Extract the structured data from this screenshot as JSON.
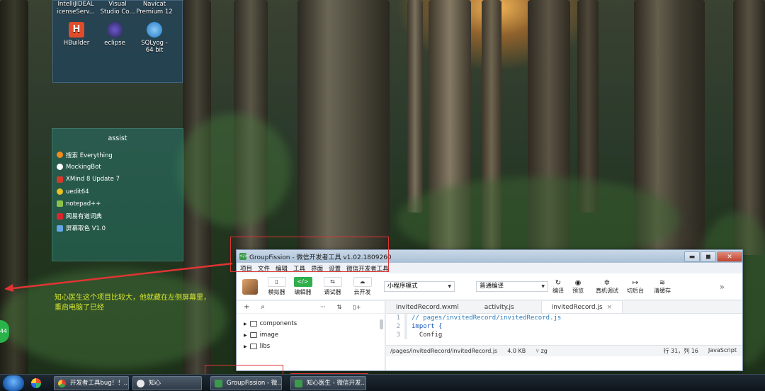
{
  "desktop": {
    "top_labels": [
      {
        "lines": [
          "IntelliJIDEAL",
          "icenseServ..."
        ]
      },
      {
        "lines": [
          "Visual",
          "Studio Co..."
        ]
      },
      {
        "lines": [
          "Navicat",
          "Premium 12"
        ]
      }
    ],
    "icons": [
      {
        "label": "HBuilder",
        "color": "#e04b2a"
      },
      {
        "label": "eclipse",
        "color": "#2c2255"
      },
      {
        "label": "SQLyog - 64 bit",
        "color": "#1f77c9"
      }
    ]
  },
  "assist": {
    "title": "assist",
    "items": [
      {
        "label": "搜索 Everything",
        "color": "#f28b1c"
      },
      {
        "label": "MockingBot",
        "color": "#ffffff"
      },
      {
        "label": "XMind 8 Update 7",
        "color": "#d33a2c"
      },
      {
        "label": "uedit64",
        "color": "#e8c21e"
      },
      {
        "label": "notepad++",
        "color": "#8bc34a"
      },
      {
        "label": "网易有道词典",
        "color": "#d8262e"
      },
      {
        "label": "屏幕取色 V1.0",
        "color": "#63a7e6"
      }
    ]
  },
  "annotation": {
    "note_line1": "知心医生这个项目比较大，他就藏在左侧屏幕里，",
    "note_line2": "重启电脑了已经",
    "red_color": "#e03434",
    "note_color": "#d7e62e"
  },
  "side_ball": {
    "label": "44"
  },
  "window": {
    "title": "GroupFission - 微信开发者工具 v1.02.1809260",
    "controls": {
      "minimize": "▬",
      "maximize": "◼",
      "close": "✕"
    },
    "menu": [
      "项目",
      "文件",
      "编辑",
      "工具",
      "界面",
      "设置",
      "微信开发者工具"
    ],
    "toolbar": {
      "buttons": [
        {
          "label": "模拟器",
          "icon": "phone-icon",
          "glyph": "▯"
        },
        {
          "label": "编辑器",
          "icon": "code-icon",
          "glyph": "</>"
        },
        {
          "label": "调试器",
          "icon": "debug-icon",
          "glyph": "⇆"
        },
        {
          "label": "云开发",
          "icon": "cloud-icon",
          "glyph": "☁"
        }
      ],
      "mode_select": "小程序模式",
      "compile_select": "普通编译",
      "actions": [
        {
          "label": "编译",
          "glyph": "↻"
        },
        {
          "label": "预览",
          "glyph": "◉"
        },
        {
          "label": "真机调试",
          "glyph": "✲"
        },
        {
          "label": "切后台",
          "glyph": "↦"
        },
        {
          "label": "清缓存",
          "glyph": "≋"
        }
      ],
      "more": "»"
    },
    "explorer": {
      "tools": [
        "+",
        "⌕",
        "···",
        "⇅",
        "▯+"
      ],
      "folders": [
        "components",
        "image",
        "libs"
      ]
    },
    "editor": {
      "tabs": [
        {
          "label": "invitedRecord.wxml",
          "active": false
        },
        {
          "label": "activity.js",
          "active": false
        },
        {
          "label": "invitedRecord.js",
          "active": true
        }
      ],
      "close_glyph": "×",
      "lines": [
        {
          "num": "1",
          "text": "// pages/invitedRecord/invitedRecord.js",
          "kind": "cm"
        },
        {
          "num": "2",
          "text": "import {",
          "kind": "kw"
        },
        {
          "num": "3",
          "text": "  Config",
          "kind": "tx"
        }
      ]
    },
    "status": {
      "path": "/pages/invitedRecord/invitedRecord.js",
      "size": "4.0 KB",
      "branch": "zg",
      "position": "行 31，列 16",
      "language": "JavaScript"
    }
  },
  "taskbar": {
    "tasks": [
      {
        "label": "开发者工具bug！！...",
        "color": "#f5b400"
      },
      {
        "label": "知心",
        "color": "#e9e9e9"
      },
      {
        "label": "GroupFission - 微...",
        "color": "#3c9a4c"
      },
      {
        "label": "知心医生 - 微信开发...",
        "color": "#3c9a4c"
      }
    ]
  }
}
